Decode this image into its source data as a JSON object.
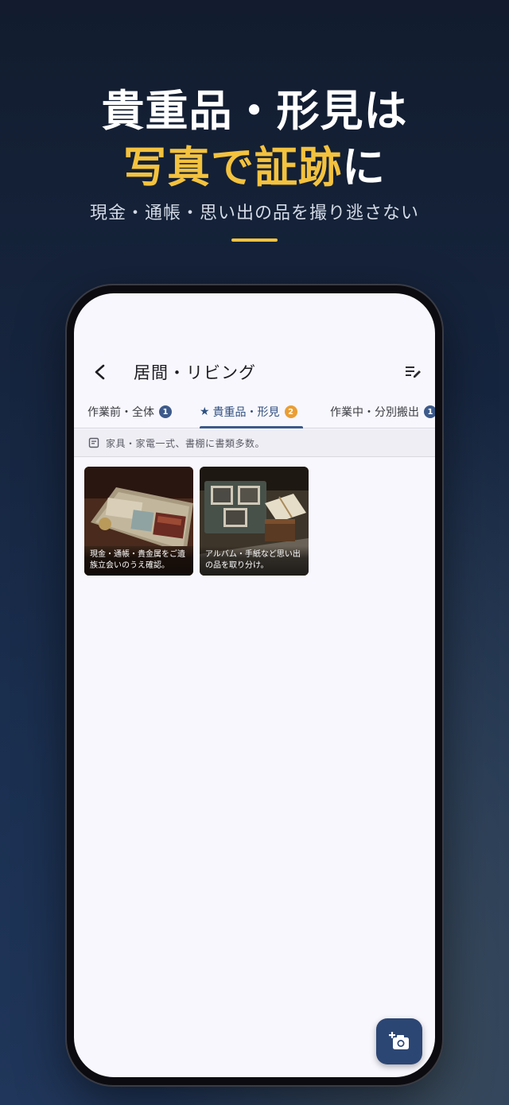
{
  "promo": {
    "headline_line1": "貴重品・形見は",
    "headline_line2_gold": "写真で証跡",
    "headline_line2_white": "に",
    "subtitle": "現金・通帳・思い出の品を撮り逃さない",
    "accent_color": "#f3c23e"
  },
  "app": {
    "title": "居間・リビング",
    "back_icon": "chevron-left-icon",
    "edit_icon": "edit-list-icon",
    "tabs": [
      {
        "label": "作業前・全体",
        "count": "1",
        "selected": false
      },
      {
        "label": "貴重品・形見",
        "count": "2",
        "selected": true,
        "icon": "star-icon"
      },
      {
        "label": "作業中・分別搬出",
        "count": "1",
        "selected": false
      }
    ],
    "note": "家具・家電一式、書棚に書類多数。",
    "photos": [
      {
        "caption": "現金・通帳・貴金属をご遺族立会いのうえ確認。"
      },
      {
        "caption": "アルバム・手紙など思い出の品を取り分け。"
      }
    ],
    "fab_icon": "add-photo-icon",
    "colors": {
      "primary": "#2c4674",
      "badge_orange": "#ea9e34",
      "background": "#f8f7fd"
    }
  }
}
